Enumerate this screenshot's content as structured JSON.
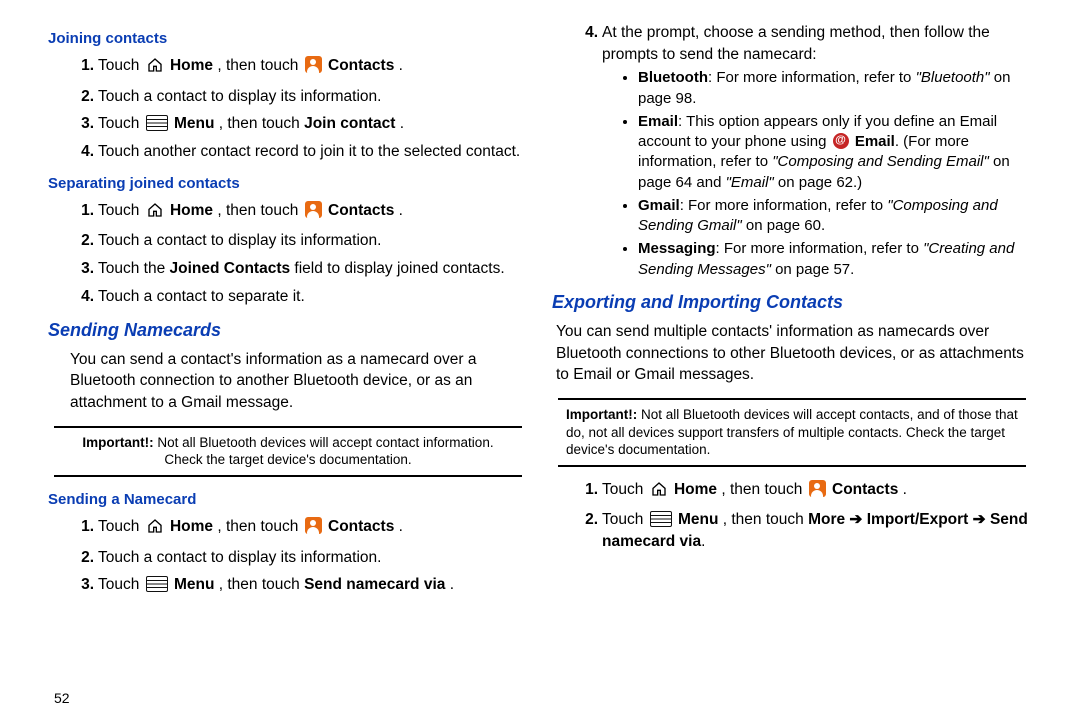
{
  "page_number": "52",
  "left": {
    "h_join": "Joining contacts",
    "join_steps": {
      "s1a": "Touch ",
      "s1b": " Home",
      "s1c": ", then touch ",
      "s1d": " Contacts",
      "s1e": ".",
      "s2": "Touch a contact to display its information.",
      "s3a": "Touch ",
      "s3b": " Menu",
      "s3c": ", then touch ",
      "s3d": "Join contact",
      "s3e": ".",
      "s4": "Touch another contact record to join it to the selected contact."
    },
    "h_sep": "Separating joined contacts",
    "sep_steps": {
      "s1a": "Touch ",
      "s1b": " Home",
      "s1c": ", then touch ",
      "s1d": " Contacts",
      "s1e": ".",
      "s2": "Touch a contact to display its information.",
      "s3a": "Touch the ",
      "s3b": "Joined Contacts",
      "s3c": " field to display joined contacts.",
      "s4": "Touch a contact to separate it."
    },
    "h_sending": "Sending Namecards",
    "sending_p": "You can send a contact's information as a namecard over a Bluetooth connection to another Bluetooth device, or as an attachment to a Gmail message.",
    "note1_lead": "Important!:",
    "note1_body": " Not all Bluetooth devices will accept contact information. Check the target device's documentation.",
    "h_send_one": "Sending a Namecard",
    "send_one": {
      "s1a": "Touch ",
      "s1b": " Home",
      "s1c": ", then touch ",
      "s1d": " Contacts",
      "s1e": ".",
      "s2": "Touch a contact to display its information.",
      "s3a": "Touch ",
      "s3b": " Menu",
      "s3c": ", then touch ",
      "s3d": "Send namecard via",
      "s3e": "."
    }
  },
  "right": {
    "step4_lead": "At the prompt, choose a sending method, then follow the prompts to send the namecard:",
    "bul_bt_a": "Bluetooth",
    "bul_bt_b": ": For more information, refer to ",
    "bul_bt_c": "\"Bluetooth\"",
    "bul_bt_d": " on page 98.",
    "bul_em_a": "Email",
    "bul_em_b": ": This option appears only if you define an Email account to your phone using ",
    "bul_em_c": " Email",
    "bul_em_d": ". (For more information, refer to ",
    "bul_em_e": "\"Composing and Sending Email\"",
    "bul_em_f": " on page 64 and ",
    "bul_em_g": "\"Email\"",
    "bul_em_h": " on page 62.)",
    "bul_gm_a": "Gmail",
    "bul_gm_b": ": For more information, refer to ",
    "bul_gm_c": "\"Composing and Sending Gmail\"",
    "bul_gm_d": " on page 60.",
    "bul_ms_a": "Messaging",
    "bul_ms_b": ": For more information, refer to ",
    "bul_ms_c": "\"Creating and Sending Messages\"",
    "bul_ms_d": " on page 57.",
    "h_export": "Exporting and Importing Contacts",
    "export_p": "You can send multiple contacts' information as namecards over Bluetooth connections to other Bluetooth devices, or as attachments to Email or Gmail messages.",
    "note2_lead": "Important!:",
    "note2_body": " Not all Bluetooth devices will accept contacts, and of those that do, not all devices support transfers of multiple contacts. Check the target device's documentation.",
    "exp_steps": {
      "s1a": "Touch ",
      "s1b": " Home",
      "s1c": ", then touch ",
      "s1d": " Contacts",
      "s1e": ".",
      "s2a": "Touch ",
      "s2b": " Menu",
      "s2c": ", then touch ",
      "s2d": "More",
      "s2e": " ➔ ",
      "s2f": "Import/Export",
      "s2g": " ➔ ",
      "s2h": "Send namecard via",
      "s2i": "."
    }
  }
}
